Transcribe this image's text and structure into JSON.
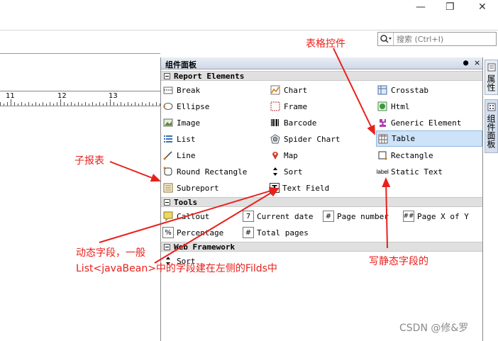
{
  "window_controls": {
    "minimize": "—",
    "restore": "❐",
    "close": "✕"
  },
  "search": {
    "placeholder": "搜索 (Ctrl+I)"
  },
  "ruler": {
    "labels": [
      "11",
      "12",
      "13"
    ]
  },
  "palette": {
    "title": "组件面板",
    "close": "×",
    "sections": [
      {
        "label": "Report Elements",
        "items": [
          {
            "label": "Break",
            "icon": "break-icon"
          },
          {
            "label": "Chart",
            "icon": "chart-icon"
          },
          {
            "label": "Crosstab",
            "icon": "crosstab-icon"
          },
          {
            "label": "Ellipse",
            "icon": "ellipse-icon"
          },
          {
            "label": "Frame",
            "icon": "frame-icon"
          },
          {
            "label": "Html",
            "icon": "html-icon"
          },
          {
            "label": "Image",
            "icon": "image-icon"
          },
          {
            "label": "Barcode",
            "icon": "barcode-icon"
          },
          {
            "label": "Generic Element",
            "icon": "generic-element-icon"
          },
          {
            "label": "List",
            "icon": "list-icon"
          },
          {
            "label": "Spider Chart",
            "icon": "spider-chart-icon"
          },
          {
            "label": "Table",
            "icon": "table-icon",
            "selected": true
          },
          {
            "label": "Line",
            "icon": "line-icon"
          },
          {
            "label": "Map",
            "icon": "map-icon"
          },
          {
            "label": "Rectangle",
            "icon": "rectangle-icon"
          },
          {
            "label": "Round Rectangle",
            "icon": "round-rectangle-icon"
          },
          {
            "label": "Sort",
            "icon": "sort-icon"
          },
          {
            "label": "Static Text",
            "icon": "static-text-icon",
            "icon_text": "label"
          },
          {
            "label": "Subreport",
            "icon": "subreport-icon"
          },
          {
            "label": "Text Field",
            "icon": "text-field-icon",
            "icon_text": "T"
          }
        ]
      },
      {
        "label": "Tools",
        "items": [
          {
            "label": "Callout",
            "icon": "callout-icon"
          },
          {
            "label": "Current date",
            "icon": "calendar-icon",
            "icon_text": "7"
          },
          {
            "label": "Page number",
            "icon": "page-number-icon",
            "icon_text": "#"
          },
          {
            "label": "Page X of Y",
            "icon": "page-x-of-y-icon",
            "icon_text": "##"
          },
          {
            "label": "Percentage",
            "icon": "percentage-icon",
            "icon_text": "%"
          },
          {
            "label": "Total pages",
            "icon": "total-pages-icon",
            "icon_text": "#"
          }
        ]
      },
      {
        "label": "Web Framework",
        "items": [
          {
            "label": "Sort",
            "icon": "sort-icon"
          }
        ]
      }
    ]
  },
  "side_tabs": [
    {
      "label": "属性"
    },
    {
      "label": "组件面板"
    }
  ],
  "annotations": {
    "table_control": "表格控件",
    "subreport": "子报表",
    "dynamic_field_line1": "动态字段，一般",
    "dynamic_field_line2": "List<javaBean>中的字段建在左侧的Filds中",
    "static_field": "写静态字段的"
  },
  "watermark": "CSDN @修&罗",
  "colors": {
    "annotation": "#e8211c",
    "selection": "#cde3f8"
  }
}
